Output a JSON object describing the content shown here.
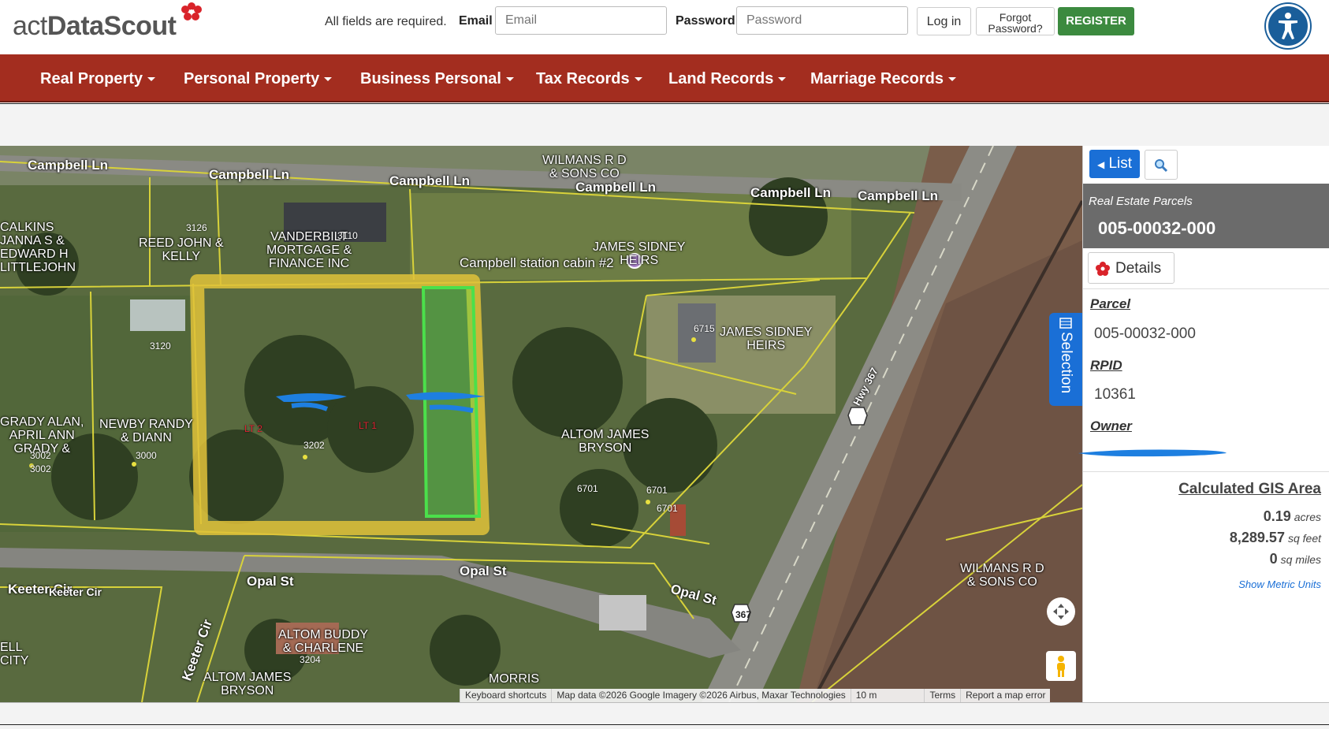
{
  "header": {
    "logo_plain": "act",
    "logo_bold": "DataScout",
    "required_note": "All fields are required.",
    "email_label": "Email",
    "email_placeholder": "Email",
    "password_label": "Password",
    "password_placeholder": "Password",
    "login_label": "Log in",
    "forgot_line1": "Forgot",
    "forgot_line2": "Password?",
    "register_label": "REGISTER",
    "accessibility_icon": "accessibility-icon"
  },
  "nav": {
    "items": [
      {
        "label": "Real Property"
      },
      {
        "label": "Personal Property"
      },
      {
        "label": "Business Personal"
      },
      {
        "label": "Tax Records"
      },
      {
        "label": "Land Records"
      },
      {
        "label": "Marriage Records"
      }
    ],
    "color": "#a32d1f"
  },
  "map": {
    "streets": [
      "Campbell Ln",
      "Campbell Ln",
      "Campbell Ln",
      "Campbell Ln",
      "Campbell Ln",
      "Campbell Ln",
      "Opal St",
      "Opal St",
      "Opal St",
      "Keeter Cir",
      "Keeter Cir",
      "Keeter Cir",
      "Hwy 367"
    ],
    "owners": {
      "wilmans_top": "WILMANS R D\n& SONS CO",
      "calkins": "CALKINS\nJANNA S &\nEDWARD H\nLITTLEJOHN",
      "reed": "REED JOHN &\nKELLY",
      "vanderbilt": "VANDERBILT\nMORTGAGE &\nFINANCE INC",
      "james_heirs_top": "JAMES SIDNEY\nHEIRS",
      "james_heirs_mid": "JAMES SIDNEY\nHEIRS",
      "grady": "GRADY ALAN,\nAPRIL ANN\nGRADY &",
      "newby": "NEWBY RANDY\n& DIANN",
      "altom_bryson_mid": "ALTOM JAMES\nBRYSON",
      "altom_buddy": "ALTOM BUDDY\n& CHARLENE",
      "altom_bryson_bottom": "ALTOM JAMES\nBRYSON",
      "morris": "MORRIS",
      "wilmans_right": "WILMANS R D\n& SONS CO",
      "ell_city": "ELL\nCITY"
    },
    "poi": "Campbell station cabin #2",
    "addresses": [
      "3126",
      "3110",
      "3120",
      "6715",
      "3202",
      "3000",
      "3002",
      "3002",
      "6701",
      "6701",
      "6701",
      "3204"
    ],
    "lot_labels": [
      "LT 2",
      "LT 1"
    ],
    "route_shield": "367",
    "attribution": {
      "shortcuts": "Keyboard shortcuts",
      "data": "Map data ©2026 Google Imagery ©2026 Airbus, Maxar Technologies",
      "scale": "10 m",
      "terms": "Terms",
      "report": "Report a map error"
    },
    "selection_tab": "Selection"
  },
  "panel": {
    "list_label": "List",
    "search_icon": "magnifier-icon",
    "subtitle": "Real Estate Parcels",
    "parcel_id": "005-00032-000",
    "details_label": "Details",
    "fields": [
      {
        "label": "Parcel",
        "value": "005-00032-000"
      },
      {
        "label": "RPID",
        "value": "10361"
      },
      {
        "label": "Owner",
        "value": ""
      }
    ],
    "gis_title": "Calculated GIS Area",
    "gis": [
      {
        "value": "0.19",
        "unit": "acres"
      },
      {
        "value": "8,289.57",
        "unit": "sq feet"
      },
      {
        "value": "0",
        "unit": "sq miles"
      }
    ],
    "metric_link": "Show Metric Units"
  },
  "colors": {
    "register_green": "#3c8a3f",
    "list_blue": "#1a6fd6",
    "parcel_yellow": "#e0c23a",
    "parcel_green": "#4be04b"
  }
}
